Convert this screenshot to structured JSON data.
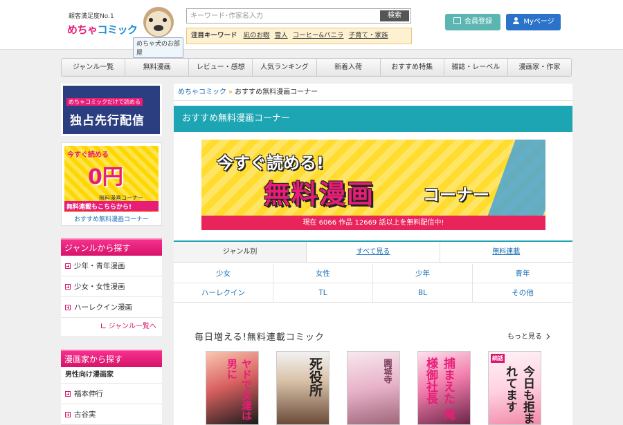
{
  "header": {
    "tagline": "顧客満足度No.1",
    "brand_prefix": "めちゃ",
    "brand_suffix": "コミック",
    "room_label": "めちゃ犬のお部屋",
    "search": {
      "placeholder": "キーワード･作家名入力",
      "button_label": "検索"
    },
    "keywords": {
      "label": "注目キーワード",
      "items": [
        "凪のお暇",
        "雪人",
        "コーヒー&バニラ",
        "子育て・家族"
      ]
    },
    "register_label": "会員登録",
    "mypage_label": "Myページ"
  },
  "nav": {
    "items": [
      "ジャンル一覧",
      "無料漫画",
      "レビュー・感想",
      "人気ランキング",
      "新着入荷",
      "おすすめ特集",
      "雑誌・レーベル",
      "漫画家・作家"
    ]
  },
  "sidebar": {
    "banner1": {
      "top_text": "めちゃコミックだけで読める",
      "main_text": "独占先行配信"
    },
    "banner2": {
      "top_text": "今すぐ読める",
      "zero_text": "0円",
      "sub_text": "無料漫画コーナー",
      "red_text": "無料連載もこちらから!",
      "caption": "おすすめ無料漫画コーナー"
    },
    "genre_box": {
      "title": "ジャンルから探す",
      "items": [
        "少年・青年漫画",
        "少女・女性漫画",
        "ハーレクイン漫画"
      ],
      "more": "ジャンル一覧へ"
    },
    "author_box": {
      "title": "漫画家から探す",
      "subhead": "男性向け漫画家",
      "items": [
        "福本伸行",
        "古谷実"
      ]
    }
  },
  "main": {
    "breadcrumb": {
      "home": "めちゃコミック",
      "current": "おすすめ無料漫画コーナー"
    },
    "title": "おすすめ無料漫画コーナー",
    "hero": {
      "line1": "今すぐ読める!",
      "line2": "無料漫画",
      "line3": "コーナー",
      "status": "現在 6066 作品 12669 話以上を無料配信中!"
    },
    "tabs": [
      "ジャンル別",
      "すべて見る",
      "無料連載"
    ],
    "genres": [
      "少女",
      "女性",
      "少年",
      "青年",
      "ハーレクイン",
      "TL",
      "BL",
      "その他"
    ],
    "section_title": "毎日増える!無料連載コミック",
    "section_more": "もっと見る",
    "covers": [
      {
        "title": "ヤドで女達は男に"
      },
      {
        "title": "死役所"
      },
      {
        "title": "園城寺"
      },
      {
        "title": "捕まえた 俺様御社長"
      },
      {
        "title": "今日も拒まれてます",
        "badge": "続話"
      }
    ]
  }
}
